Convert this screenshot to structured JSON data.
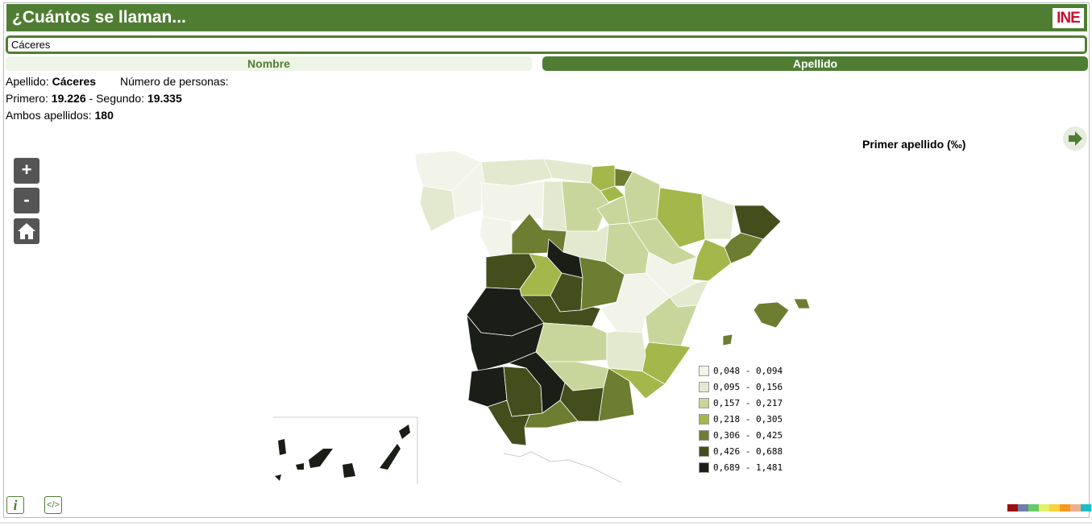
{
  "header": {
    "title": "¿Cuántos se llaman...",
    "logo_text": "INE"
  },
  "search": {
    "value": "Cáceres"
  },
  "tabs": [
    {
      "label": "Nombre",
      "active": false
    },
    {
      "label": "Apellido",
      "active": true
    }
  ],
  "info": {
    "apellido_label": "Apellido:",
    "apellido_value": "Cáceres",
    "personas_label": "Número de personas:",
    "primero_label": "Primero:",
    "primero_value": "19.226",
    "segundo_label": "- Segundo:",
    "segundo_value": "19.335",
    "ambos_label": "Ambos apellidos:",
    "ambos_value": "180"
  },
  "zoom": {
    "plus": "+",
    "minus": "-"
  },
  "map": {
    "title": "Primer apellido (‰)"
  },
  "legend": [
    {
      "label": "0,048 - 0,094",
      "color": "#f2f4ea"
    },
    {
      "label": "0,095 - 0,156",
      "color": "#e3e9cf"
    },
    {
      "label": "0,157 - 0,217",
      "color": "#c9d69b"
    },
    {
      "label": "0,218 - 0,305",
      "color": "#a3b74b"
    },
    {
      "label": "0,306 - 0,425",
      "color": "#6d7d31"
    },
    {
      "label": "0,426 - 0,688",
      "color": "#444e1d"
    },
    {
      "label": "0,689 - 1,481",
      "color": "#1b1d17"
    }
  ],
  "footer": {
    "info_glyph": "i",
    "embed_glyph": "</>"
  },
  "palette": [
    "#9b0f0f",
    "#6f80a8",
    "#66cc66",
    "#e3ef6b",
    "#f7d33d",
    "#f59a1c",
    "#f0b090",
    "#1dbdc6",
    "#d8d8ee"
  ]
}
